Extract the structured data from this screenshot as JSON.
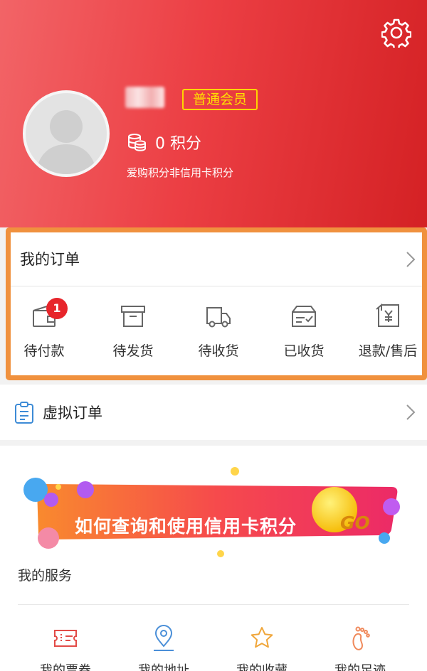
{
  "profile": {
    "member_badge": "普通会员",
    "points_text": "0 积分",
    "points_note": "爱购积分非信用卡积分"
  },
  "orders": {
    "title": "我的订单",
    "items": [
      {
        "label": "待付款",
        "icon": "wallet-icon",
        "badge": "1"
      },
      {
        "label": "待发货",
        "icon": "box-icon"
      },
      {
        "label": "待收货",
        "icon": "truck-icon"
      },
      {
        "label": "已收货",
        "icon": "received-icon"
      },
      {
        "label": "退款/售后",
        "icon": "refund-icon"
      }
    ]
  },
  "virtual_order": {
    "title": "虚拟订单",
    "icon": "clipboard-icon"
  },
  "banner": {
    "text": "如何查询和使用信用卡积分",
    "go": "GO"
  },
  "services": {
    "title": "我的服务",
    "items": [
      {
        "label": "我的票券",
        "icon": "ticket-icon"
      },
      {
        "label": "我的地址",
        "icon": "location-icon"
      },
      {
        "label": "我的收藏",
        "icon": "star-icon"
      },
      {
        "label": "我的足迹",
        "icon": "footprint-icon"
      }
    ]
  },
  "colors": {
    "header_red": "#ec3f44",
    "badge_yellow": "#ffe100",
    "highlight_orange": "#f0913e",
    "notification_red": "#e7252b"
  }
}
